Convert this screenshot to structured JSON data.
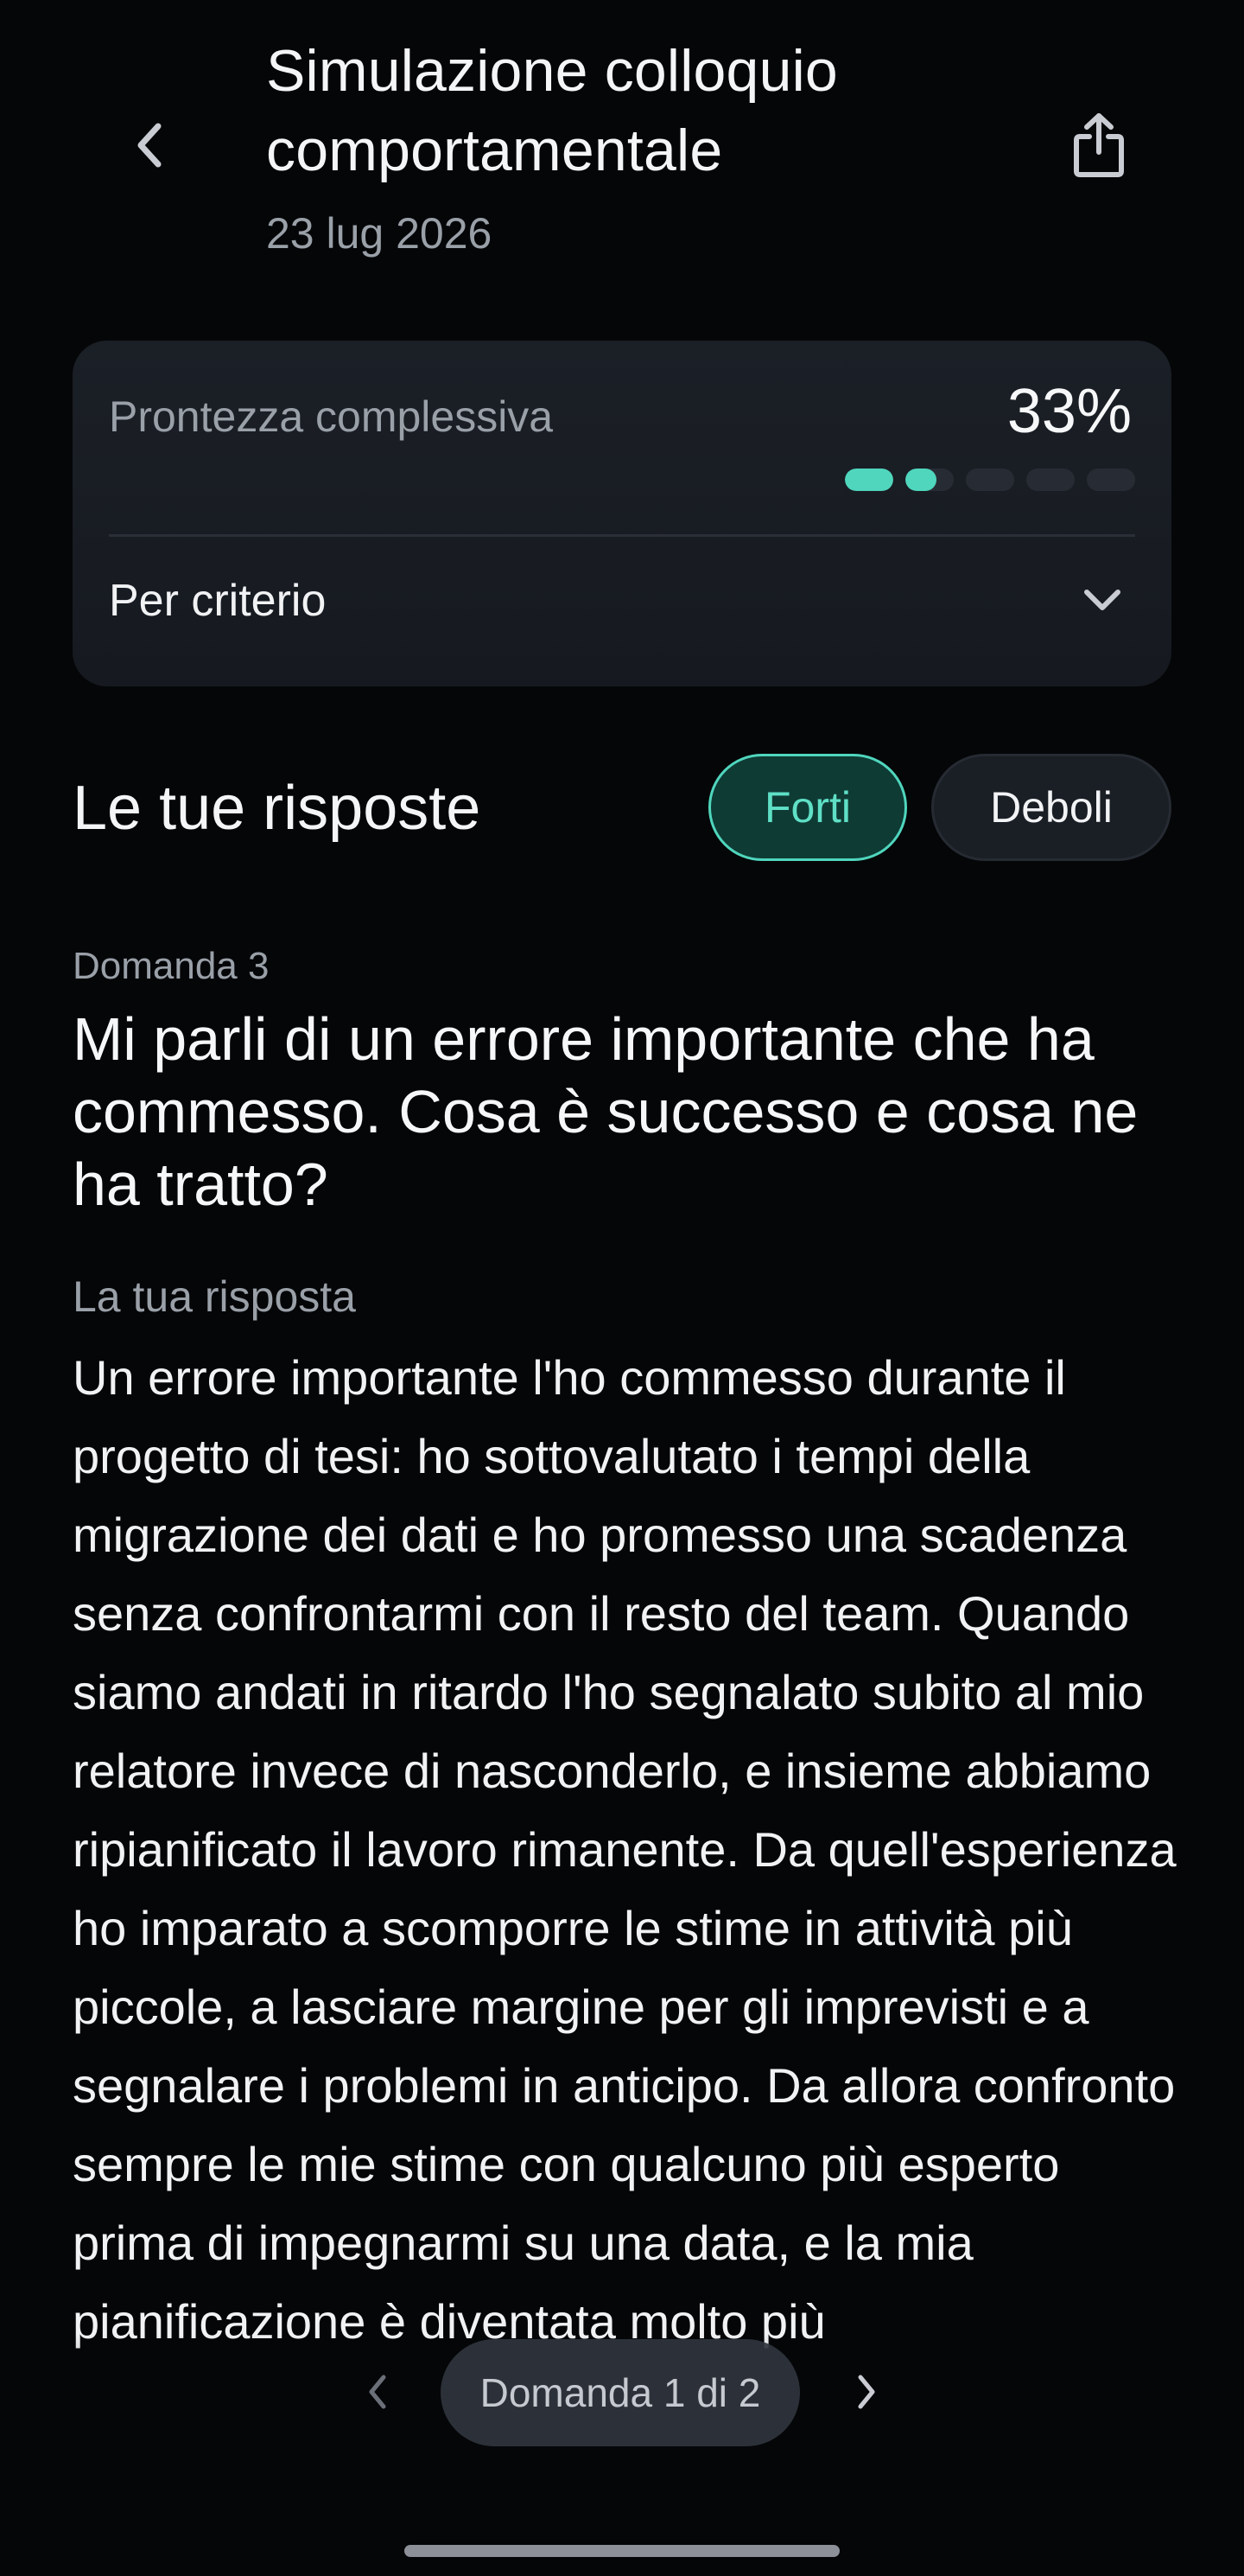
{
  "header": {
    "title": "Simulazione colloquio comportamentale",
    "date": "23 lug 2026",
    "back_icon": "chevron-left-icon",
    "share_icon": "share-icon"
  },
  "readiness": {
    "label": "Prontezza complessiva",
    "percent_text": "33%",
    "meter": {
      "segments": 5,
      "filled_fraction": 0.33,
      "accent_color": "#4fd6bd",
      "track_color": "#272c34"
    },
    "criteria_label": "Per criterio",
    "criteria_icon": "chevron-down-icon"
  },
  "answers": {
    "title": "Le tue risposte",
    "filters": {
      "strong": "Forti",
      "weak": "Deboli",
      "selected": "strong"
    },
    "question_number": "Domanda 3",
    "question_text": "Mi parli di un errore importante che ha commesso. Cosa è successo e cosa ne ha tratto?",
    "answer_label": "La tua risposta",
    "answer_text": "Un errore importante l'ho commesso durante il progetto di tesi: ho sottovalutato i tempi della migrazione dei dati e ho promesso una scadenza senza confrontarmi con il resto del team. Quando siamo andati in ritardo l'ho segnalato subito al mio relatore invece di nasconderlo, e insieme abbiamo ripianificato il lavoro rimanente. Da quell'esperienza ho imparato a scomporre le stime in attività più piccole, a lasciare margine per gli imprevisti e a segnalare i problemi in anticipo. Da allora confronto sempre le mie stime con qualcuno più esperto prima di impegnarmi su una data, e la mia pianificazione è diventata molto più"
  },
  "pager": {
    "label": "Domanda 1 di 2",
    "prev_icon": "chevron-left-icon",
    "next_icon": "chevron-right-icon"
  },
  "colors": {
    "background": "#050608",
    "card": "#1b1f26",
    "accent": "#4fd6bd",
    "muted_text": "#9aa0a8"
  }
}
